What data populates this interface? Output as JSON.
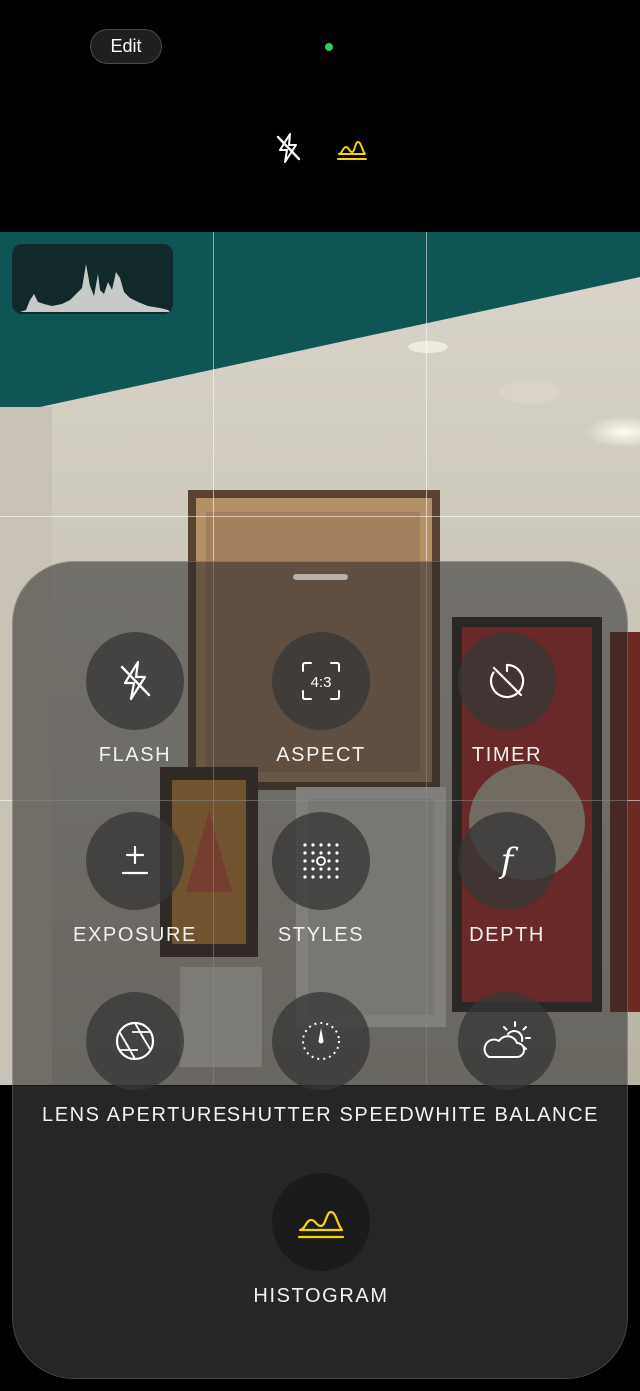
{
  "top_bar": {
    "edit_label": "Edit",
    "status_color": "#34c759",
    "icons": [
      "flash-off-icon",
      "histogram-icon"
    ],
    "accent_color": "#f5d10a"
  },
  "controls": [
    {
      "id": "flash",
      "label": "FLASH",
      "icon": "flash-auto-icon"
    },
    {
      "id": "aspect",
      "label": "ASPECT",
      "icon": "aspect-ratio-icon",
      "icon_text": "4:3"
    },
    {
      "id": "timer",
      "label": "TIMER",
      "icon": "timer-off-icon"
    },
    {
      "id": "exposure",
      "label": "EXPOSURE",
      "icon": "plus-minus-icon"
    },
    {
      "id": "styles",
      "label": "STYLES",
      "icon": "dot-grid-icon"
    },
    {
      "id": "depth",
      "label": "DEPTH",
      "icon": "f-stop-icon",
      "icon_text": "f"
    },
    {
      "id": "lens-aperture",
      "label": "LENS APERTURE",
      "icon": "aperture-icon"
    },
    {
      "id": "shutter-speed",
      "label": "SHUTTER SPEED",
      "icon": "shutter-dial-icon"
    },
    {
      "id": "white-balance",
      "label": "WHITE BALANCE",
      "icon": "cloud-sun-icon"
    },
    {
      "id": "histogram",
      "label": "HISTOGRAM",
      "icon": "histogram-icon"
    }
  ]
}
